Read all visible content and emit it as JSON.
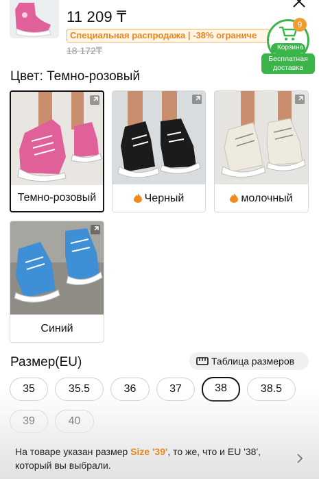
{
  "header": {
    "price": "11 209 ₸",
    "promo": "Специальная распродажа | -38% ограниче",
    "old_price": "18 172₸",
    "cart_label": "Корзина",
    "cart_count": "9",
    "free_shipping_line1": "Бесплатная",
    "free_shipping_line2": "доставка"
  },
  "color": {
    "title": "Цвет: Темно-розовый",
    "options": [
      {
        "label": "Темно-розовый",
        "selected": true,
        "shoe_color": "#e0609a"
      },
      {
        "label": "Черный",
        "selected": false,
        "shoe_color": "#1b1b1b"
      },
      {
        "label": "молочный",
        "selected": false,
        "shoe_color": "#eeeae0"
      },
      {
        "label": "Синий",
        "selected": false,
        "shoe_color": "#3f8fd6"
      }
    ]
  },
  "size": {
    "title": "Размер(EU)",
    "table_label": "Таблица размеров",
    "options": [
      "35",
      "35.5",
      "36",
      "37",
      "38",
      "38.5",
      "39",
      "40"
    ],
    "selected": "38"
  },
  "notice": {
    "text_before": "На товаре указан размер ",
    "highlight": "Size '39'",
    "text_after": ", то же, что и EU '38', который вы выбрали."
  },
  "colors": {
    "accent_green": "#3bb44a",
    "accent_orange": "#e8851f",
    "badge_orange": "#f29a2e"
  },
  "icons": [
    "close-icon",
    "cart-icon",
    "expand-icon",
    "fire-icon",
    "ruler-icon",
    "chevron-right-icon"
  ]
}
